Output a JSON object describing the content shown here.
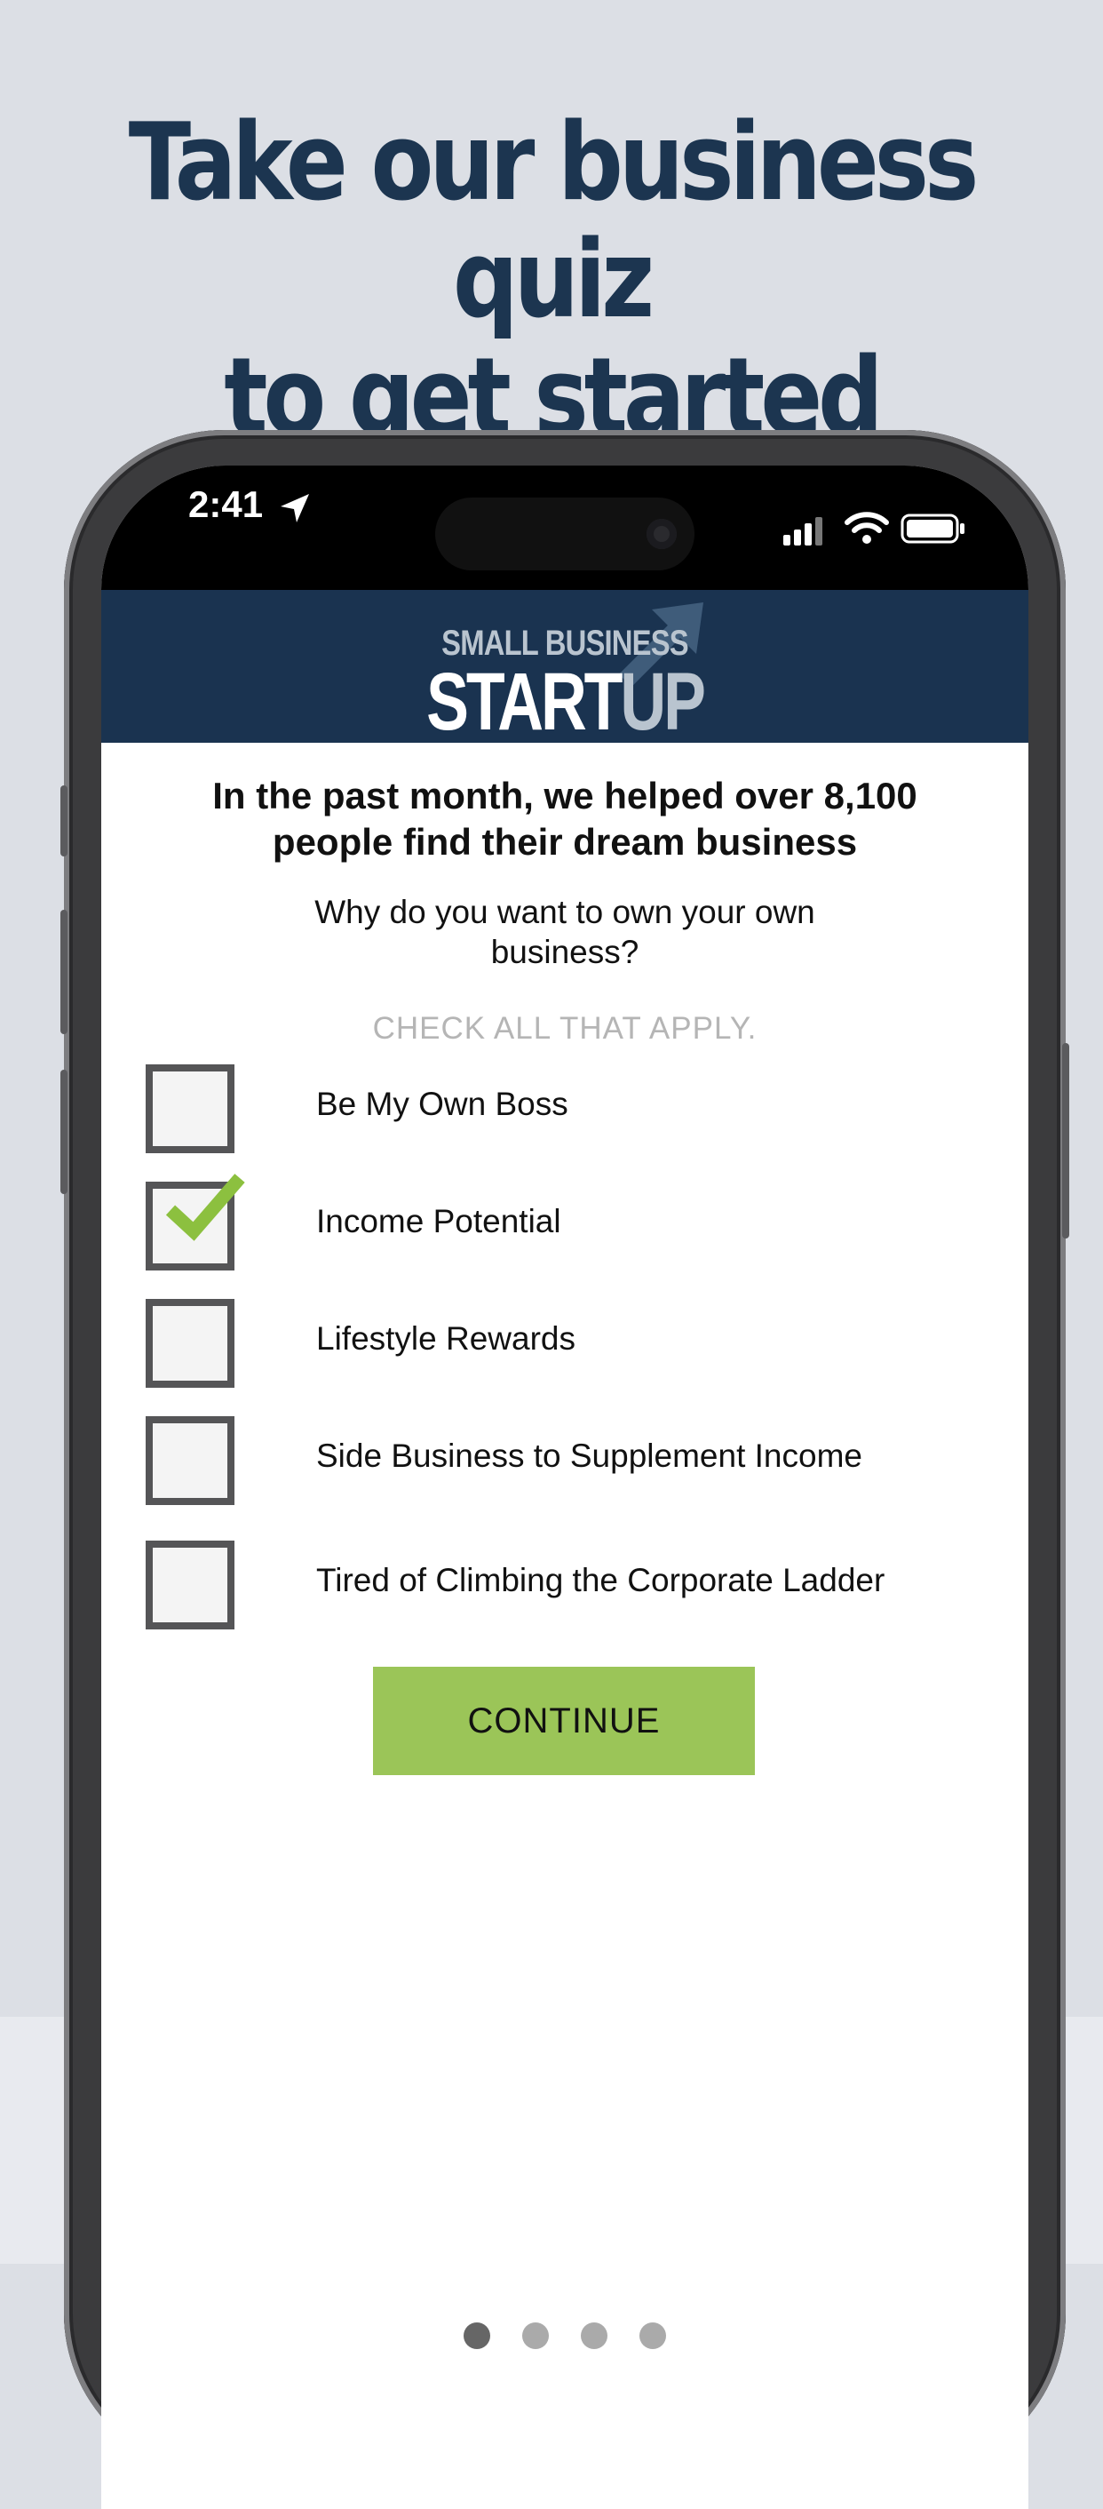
{
  "headline": {
    "line1": "Take our business quiz",
    "line2": "to get started"
  },
  "status_bar": {
    "time": "2:41",
    "icons": [
      "location-arrow-icon",
      "cellular-signal-icon",
      "wifi-icon",
      "battery-icon"
    ]
  },
  "brand": {
    "small": "SMALL BUSINESS",
    "big_part1": "START",
    "big_part2": "UP",
    "colors": {
      "bar": "#1a3350",
      "accent": "#b9c4cf"
    }
  },
  "quiz": {
    "heading": "In the past month, we helped over 8,100 people find their dream business",
    "question": "Why do you want to own your own business?",
    "hint": "CHECK ALL THAT APPLY.",
    "options": [
      {
        "label": "Be My Own Boss",
        "checked": false
      },
      {
        "label": "Income Potential",
        "checked": true
      },
      {
        "label": "Lifestyle Rewards",
        "checked": false
      },
      {
        "label": "Side Business to Supplement Income",
        "checked": false
      },
      {
        "label": "Tired of Climbing the Corporate Ladder",
        "checked": false
      }
    ],
    "continue_label": "CONTINUE",
    "continue_color": "#9bc558",
    "check_color": "#8cc03f"
  },
  "pagination": {
    "total": 4,
    "active": 1
  }
}
